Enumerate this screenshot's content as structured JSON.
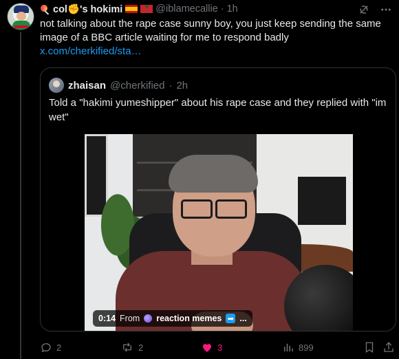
{
  "tweet": {
    "display_name": "col✊'s hokimi",
    "handle": "@iblamecallie",
    "separator": "·",
    "time": "1h",
    "text": "not talking about the rape case sunny boy, you just keep sending the same image of a BBC article waiting for me to respond badly",
    "link": "x.com/cherkified/sta…"
  },
  "quote": {
    "display_name": "zhaisan",
    "handle": "@cherkified",
    "separator": "·",
    "time": "2h",
    "text": "Told a \"hakimi yumeshipper\" about his rape case and they replied with \"im wet\"",
    "video": {
      "time": "0:14",
      "from_label": "From",
      "source": "reaction memes",
      "more": "..."
    }
  },
  "actions": {
    "replies": "2",
    "reposts": "2",
    "likes": "3",
    "views": "899"
  },
  "colors": {
    "background": "#000000",
    "text": "#e7e9ea",
    "muted": "#71767b",
    "link": "#1d9bf0",
    "like": "#f91880",
    "border": "#2f3336"
  },
  "icons": [
    "lollipop-icon",
    "spain-flag-icon",
    "morocco-flag-icon",
    "grok-icon",
    "more-icon",
    "reply-icon",
    "repost-icon",
    "like-icon",
    "views-icon",
    "bookmark-icon",
    "share-icon"
  ]
}
